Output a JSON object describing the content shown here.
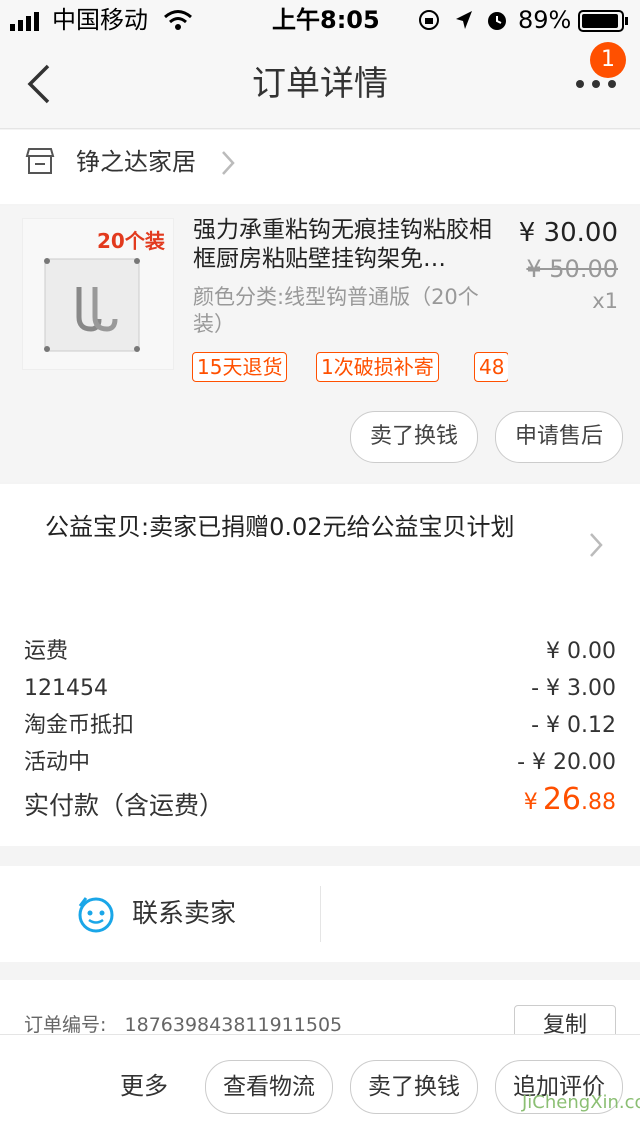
{
  "status": {
    "carrier": "中国移动",
    "time": "上午8:05",
    "battery": "89%"
  },
  "nav": {
    "title": "订单详情",
    "badge": "1"
  },
  "shop": {
    "name": "铮之达家居"
  },
  "product": {
    "image_label": "20个装",
    "title": "强力承重粘钩无痕挂钩粘胶相框厨房粘贴壁挂钩架免…",
    "price": "¥ 30.00",
    "original_price": "¥ 50.00",
    "quantity": "x1",
    "sku": "颜色分类:线型钩普通版（20个装）",
    "tags": [
      "15天退货",
      "1次破损补寄",
      "48"
    ],
    "buttons": {
      "sell": "卖了换钱",
      "after_sale": "申请售后"
    }
  },
  "charity": {
    "text": "公益宝贝:卖家已捐赠0.02元给公益宝贝计划"
  },
  "fees": [
    {
      "label": "运费",
      "value": "¥ 0.00"
    },
    {
      "label": "121454",
      "value": "- ¥ 3.00"
    },
    {
      "label": "淘金币抵扣",
      "value": "- ¥ 0.12"
    },
    {
      "label": "活动中",
      "value": "- ¥ 20.00"
    }
  ],
  "total": {
    "label": "实付款（含运费）",
    "currency": "¥",
    "integer": "26",
    "decimal": ".88"
  },
  "contact": {
    "label": "联系卖家"
  },
  "order": {
    "label": "订单编号:",
    "number": "187639843811911505",
    "copy": "复制"
  },
  "bottom": {
    "more": "更多",
    "logistics": "查看物流",
    "sell": "卖了换钱",
    "review": "追加评价"
  },
  "watermark": "JiChengXin.com",
  "colors": {
    "accent": "#ff5000",
    "contact_icon": "#1aa6e8"
  }
}
